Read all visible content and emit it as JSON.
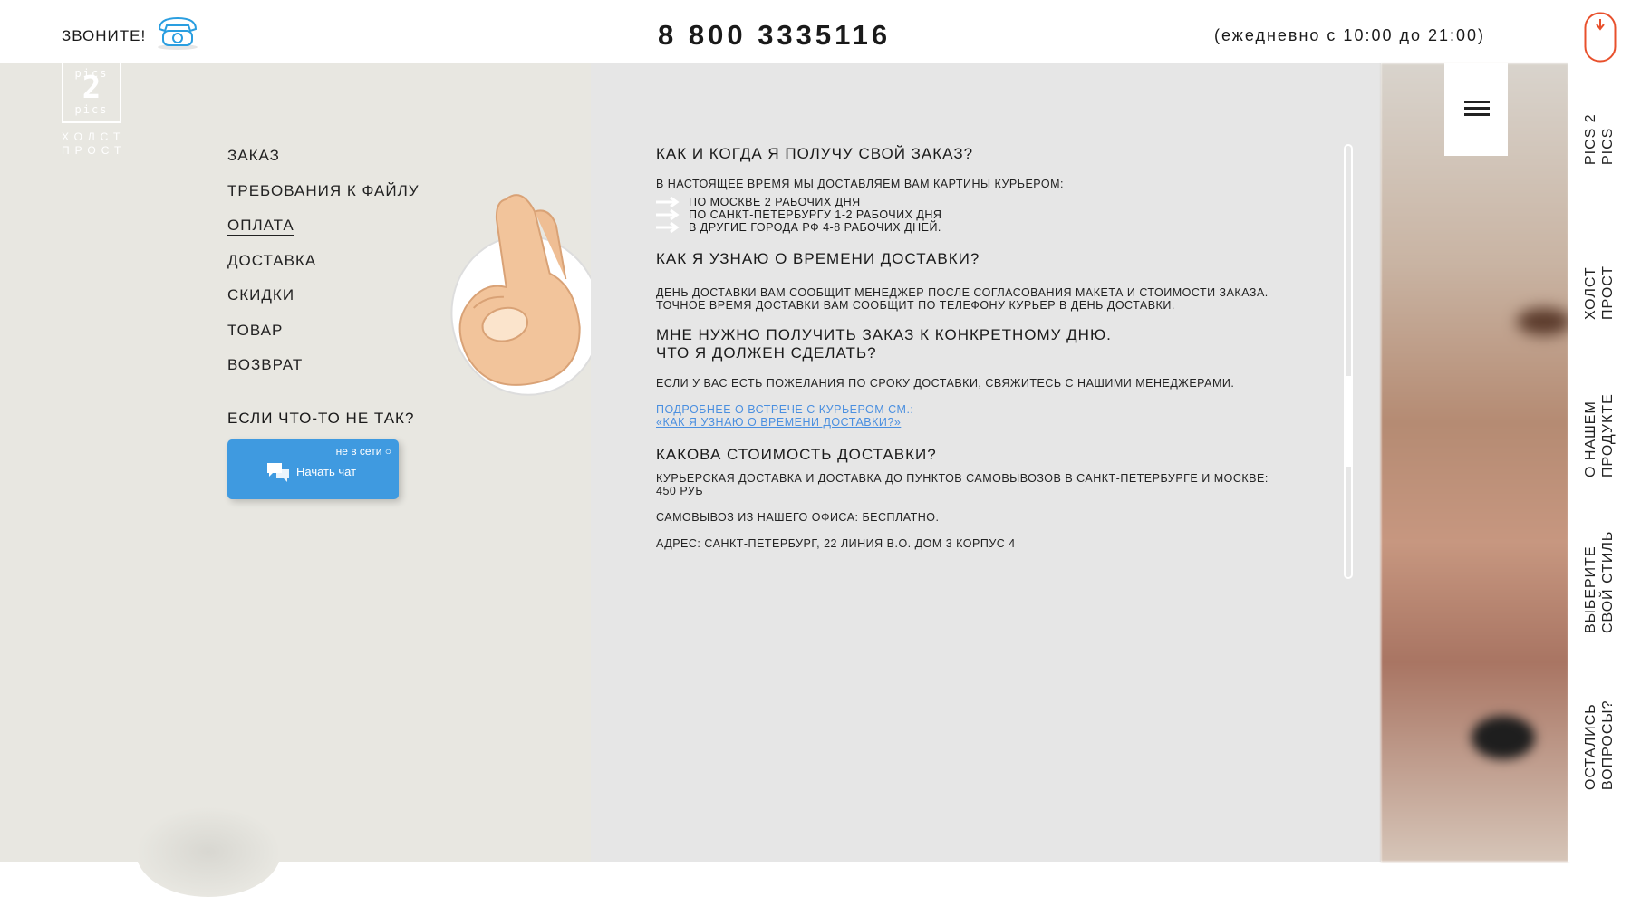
{
  "header": {
    "call_label": "ЗВОНИТЕ!",
    "phone_number": "8 800 3335116",
    "hours": "(ежедневно с 10:00 до 21:00)"
  },
  "logo": {
    "top": "pics",
    "digit": "2",
    "bottom": "pics",
    "line1": "ХОЛСТ",
    "line2": "ПРОСТ"
  },
  "menu": {
    "items": [
      {
        "label": "ЗАКАЗ"
      },
      {
        "label": "ТРЕБОВАНИЯ К ФАЙЛУ"
      },
      {
        "label": "ОПЛАТА"
      },
      {
        "label": "ДОСТАВКА"
      },
      {
        "label": "СКИДКИ"
      },
      {
        "label": "ТОВАР"
      },
      {
        "label": "ВОЗВРАТ"
      }
    ],
    "active_index": 2
  },
  "help": {
    "title": "ЕСЛИ ЧТО-ТО НЕ ТАК?",
    "chat_status": "не в сети",
    "chat_label": "Начать чат"
  },
  "faq": {
    "q1": "КАК И КОГДА Я ПОЛУЧУ СВОЙ ЗАКАЗ?",
    "a1": "В НАСТОЯЩЕЕ ВРЕМЯ МЫ ДОСТАВЛЯЕМ ВАМ КАРТИНЫ КУРЬЕРОМ:",
    "a1_list": [
      "ПО МОСКВЕ 2 РАБОЧИХ ДНЯ",
      "ПО САНКТ-ПЕТЕРБУРГУ 1-2 РАБОЧИХ ДНЯ",
      "В ДРУГИЕ ГОРОДА РФ 4-8 РАБОЧИХ ДНЕЙ."
    ],
    "q2": "КАК Я УЗНАЮ О ВРЕМЕНИ ДОСТАВКИ?",
    "a2_l1": "ДЕНЬ ДОСТАВКИ ВАМ СООБЩИТ МЕНЕДЖЕР ПОСЛЕ СОГЛАСОВАНИЯ МАКЕТА И СТОИМОСТИ ЗАКАЗА.",
    "a2_l2": "ТОЧНОЕ ВРЕМЯ ДОСТАВКИ ВАМ СООБЩИТ ПО ТЕЛЕФОНУ КУРЬЕР В ДЕНЬ ДОСТАВКИ.",
    "q3_l1": "МНЕ НУЖНО ПОЛУЧИТЬ ЗАКАЗ К КОНКРЕТНОМУ ДНЮ.",
    "q3_l2": "ЧТО Я ДОЛЖЕН СДЕЛАТЬ?",
    "a3": "ЕСЛИ У ВАС ЕСТЬ ПОЖЕЛАНИЯ ПО СРОКУ ДОСТАВКИ, СВЯЖИТЕСЬ С НАШИМИ МЕНЕДЖЕРАМИ.",
    "a3_link_prefix": "ПОДРОБНЕЕ О ВСТРЕЧЕ С КУРЬЕРОМ СМ.:",
    "a3_link": "«КАК Я УЗНАЮ О ВРЕМЕНИ ДОСТАВКИ?»",
    "q4": "КАКОВА СТОИМОСТЬ ДОСТАВКИ?",
    "a4_l1": "КУРЬЕРСКАЯ ДОСТАВКА И ДОСТАВКА ДО ПУНКТОВ САМОВЫВОЗОВ В САНКТ-ПЕТЕРБУРГЕ И МОСКВЕ:",
    "a4_l2": "450 РУБ",
    "a4_p2": "САМОВЫВОЗ ИЗ НАШЕГО ОФИСА: БЕСПЛАТНО.",
    "a4_p3": "АДРЕС: САНКТ-ПЕТЕРБУРГ, 22 ЛИНИЯ В.О. ДОМ 3 КОРПУС 4"
  },
  "sidebar": {
    "nav": [
      {
        "label": "PICS 2\nPICS"
      },
      {
        "label": "ХОЛСТ\nПРОСТ"
      },
      {
        "label": "О НАШЕМ\nПРОДУКТЕ"
      },
      {
        "label": "ВЫБЕРИТЕ\nСВОЙ СТИЛЬ"
      },
      {
        "label": "ОСТАЛИСЬ\nВОПРОСЫ?"
      }
    ]
  },
  "colors": {
    "accent": "#e8502c",
    "chat_blue": "#3f9ae0",
    "link_blue": "#4a8fe0",
    "phone_icon": "#2a9ee0"
  },
  "icons": [
    "phone-icon",
    "ok-hand-icon",
    "chat-bubbles-icon",
    "menu-icon",
    "mouse-scroll-icon",
    "arrow-bullet-icon"
  ]
}
